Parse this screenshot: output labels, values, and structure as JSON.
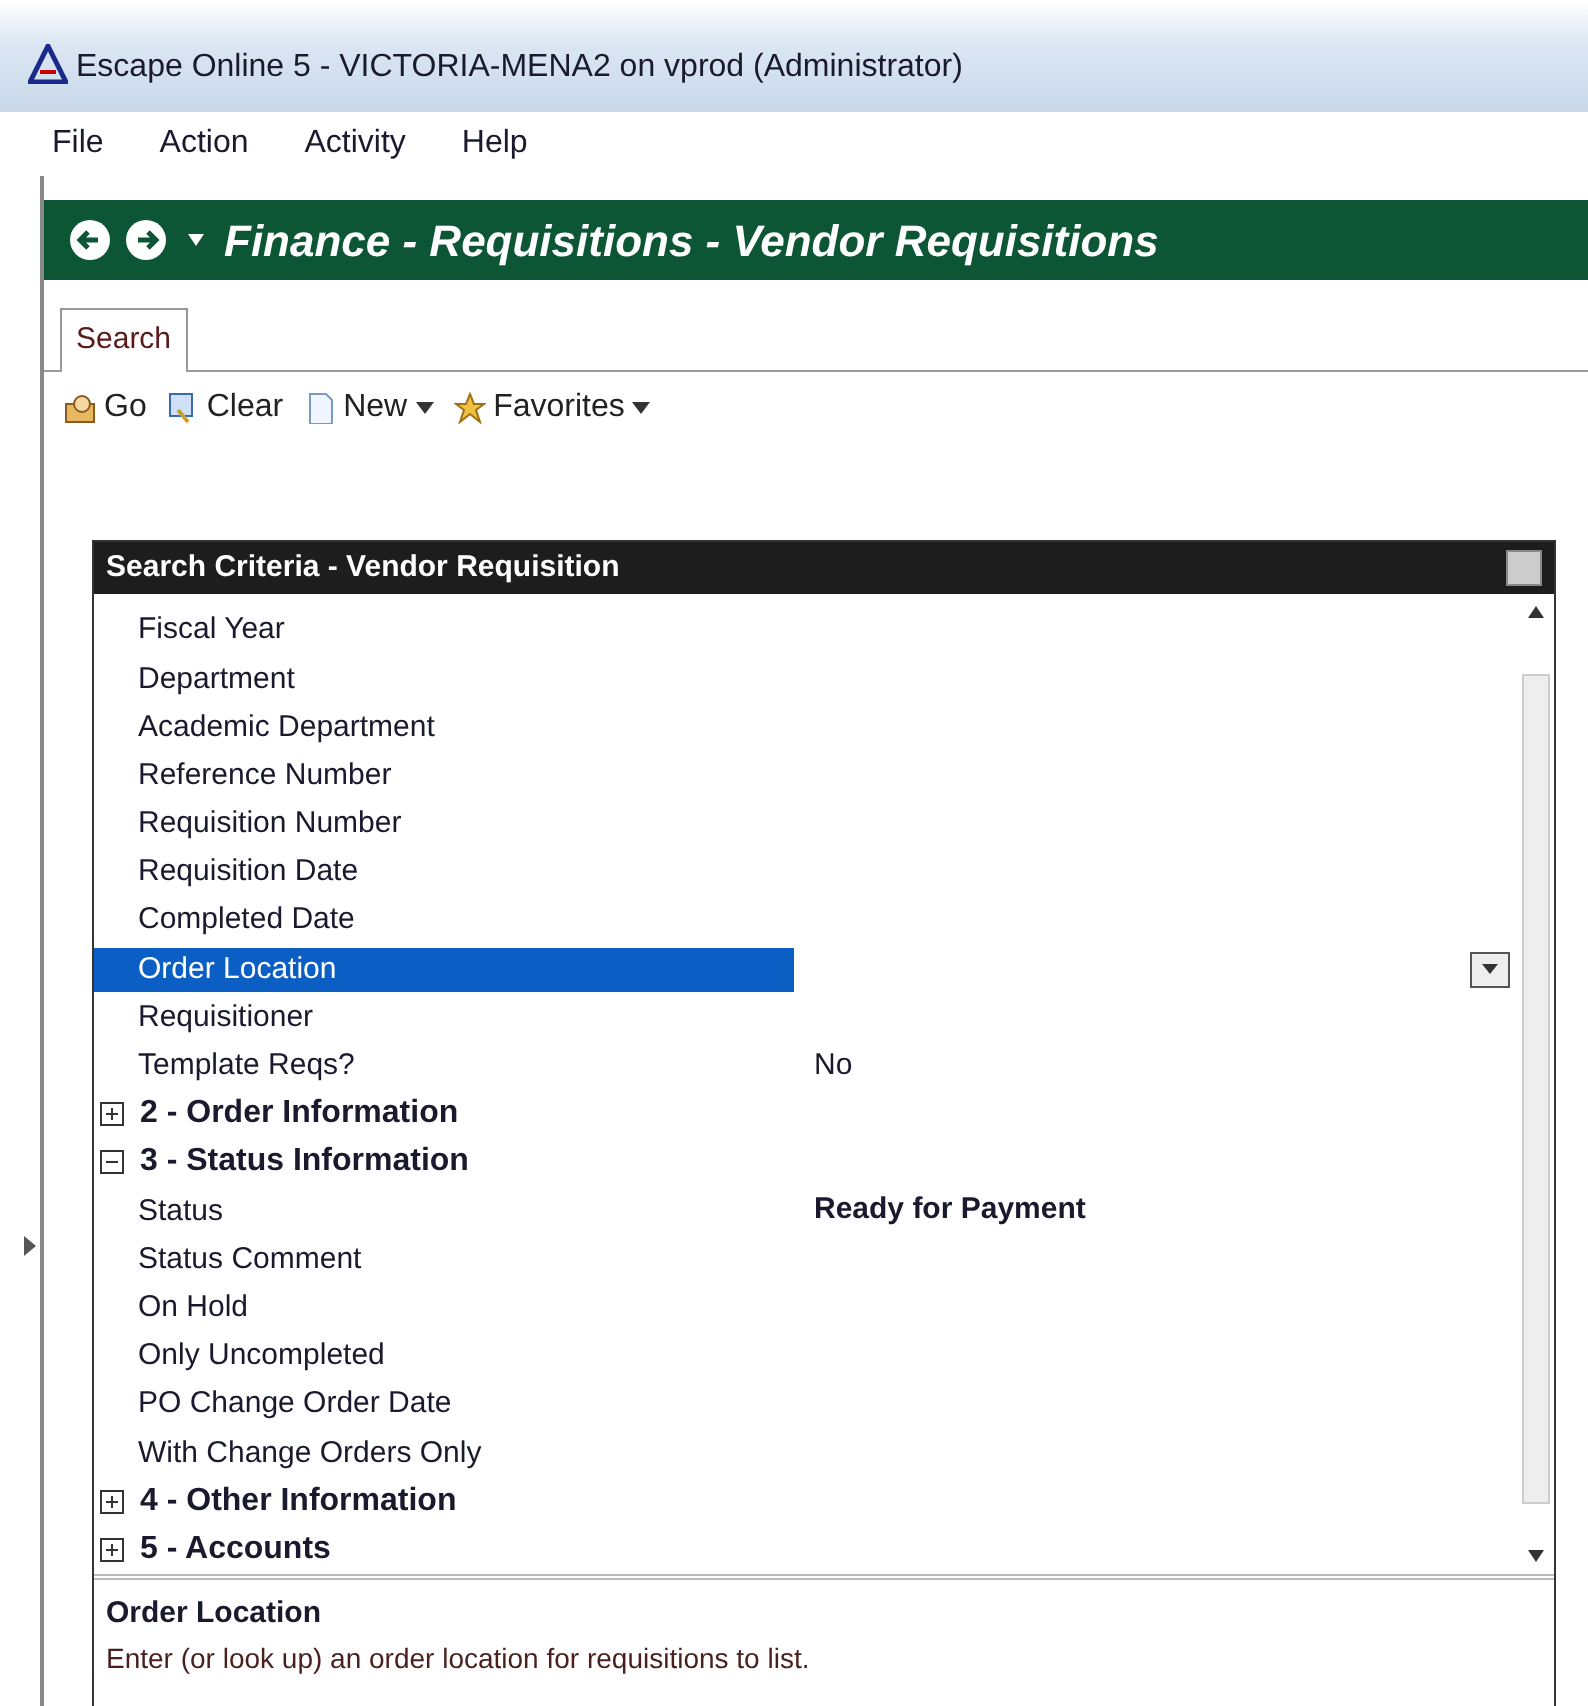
{
  "window": {
    "title": "Escape Online 5 - VICTORIA-MENA2 on vprod (Administrator)"
  },
  "menu": [
    "File",
    "Action",
    "Activity",
    "Help"
  ],
  "header": {
    "title": "Finance - Requisitions - Vendor Requisitions"
  },
  "tabs": [
    {
      "label": "Search",
      "selected": true
    }
  ],
  "toolbar": [
    {
      "label": "Go",
      "kind": "go",
      "dropdown": false
    },
    {
      "label": "Clear",
      "kind": "clear",
      "dropdown": false
    },
    {
      "label": "New",
      "kind": "new",
      "dropdown": true
    },
    {
      "label": "Favorites",
      "kind": "favorites",
      "dropdown": true
    }
  ],
  "panel": {
    "title": "Search Criteria - Vendor Requisition",
    "rows": [
      {
        "kind": "property",
        "label": "Fiscal Year",
        "selected": false
      },
      {
        "kind": "property",
        "label": "Department",
        "selected": false
      },
      {
        "kind": "property",
        "label": "Academic Department",
        "selected": false
      },
      {
        "kind": "property",
        "label": "Reference Number",
        "selected": false
      },
      {
        "kind": "property",
        "label": "Requisition Number",
        "selected": false
      },
      {
        "kind": "property",
        "label": "Requisition Date",
        "selected": false
      },
      {
        "kind": "property",
        "label": "Completed Date",
        "selected": false
      },
      {
        "kind": "property",
        "label": "Order Location",
        "selected": true
      },
      {
        "kind": "property",
        "label": "Requisitioner",
        "selected": false
      },
      {
        "kind": "property",
        "label": "Template Reqs?",
        "value": "No",
        "selected": false
      },
      {
        "kind": "group",
        "label": "2 - Order Information",
        "expanded": false
      },
      {
        "kind": "group",
        "label": "3 - Status Information",
        "expanded": true
      },
      {
        "kind": "property",
        "label": "Status",
        "value": "Ready for Payment",
        "selected": false
      },
      {
        "kind": "property",
        "label": "Status Comment",
        "selected": false
      },
      {
        "kind": "property",
        "label": "On Hold",
        "selected": false
      },
      {
        "kind": "property",
        "label": "Only Uncompleted",
        "selected": false
      },
      {
        "kind": "property",
        "label": "PO Change Order Date",
        "selected": false
      },
      {
        "kind": "property",
        "label": "With Change Orders Only",
        "selected": false
      },
      {
        "kind": "group",
        "label": "4 - Other Information",
        "expanded": false
      },
      {
        "kind": "group",
        "label": "5 - Accounts",
        "expanded": false
      }
    ],
    "help": {
      "title": "Order Location",
      "text": "Enter (or look up) an order location for requisitions to list."
    }
  }
}
